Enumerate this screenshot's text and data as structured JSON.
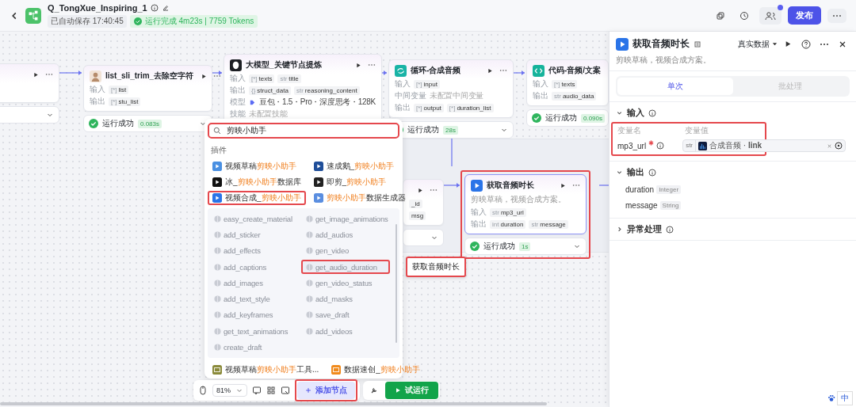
{
  "header": {
    "title": "Q_TongXue_Inspiring_1",
    "autosave": "已自动保存 17:40:45",
    "run_status": "运行完成 4m23s | 7759 Tokens",
    "publish": "发布"
  },
  "nodes": [
    {
      "kind": "full",
      "title": "list_sli_trim_去除空字符",
      "rows": [
        {
          "kind": "params",
          "label": "输入",
          "params": [
            {
              "type": "[*]",
              "name": "list"
            }
          ]
        },
        {
          "kind": "params",
          "label": "输出",
          "params": [
            {
              "type": "[*]",
              "name": "stu_list"
            }
          ]
        }
      ],
      "status": {
        "success": true,
        "text": "运行成功",
        "time": "0.083s"
      }
    },
    {
      "kind": "full",
      "title": "大模型_关键节点提炼",
      "rows": [
        {
          "kind": "params",
          "label": "输入",
          "params": [
            {
              "type": "[*]",
              "name": "texts"
            },
            {
              "type": "str",
              "name": "title"
            }
          ]
        },
        {
          "kind": "params",
          "label": "输出",
          "params": [
            {
              "type": "{}",
              "name": "struct_data"
            },
            {
              "type": "str",
              "name": "reasoning_content"
            }
          ]
        },
        {
          "kind": "text",
          "label": "模型",
          "value": "豆包・1.5・Pro・深度思考・128K",
          "muted": false,
          "logo": true
        },
        {
          "kind": "text",
          "label": "技能",
          "value": "未配置技能",
          "muted": true,
          "logo": false
        }
      ]
    },
    {
      "kind": "full",
      "title": "循环-合成音频",
      "rows": [
        {
          "kind": "params",
          "label": "输入",
          "params": [
            {
              "type": "[*]",
              "name": "input"
            }
          ]
        },
        {
          "kind": "text",
          "label": "中间变量",
          "value": "未配置中间变量",
          "muted": true,
          "logo": false
        },
        {
          "kind": "params",
          "label": "输出",
          "params": [
            {
              "type": "[*]",
              "name": "output"
            },
            {
              "type": "[*]",
              "name": "duration_list"
            }
          ]
        }
      ],
      "status": {
        "success": true,
        "text": "运行成功",
        "time": "28s"
      }
    },
    {
      "kind": "full",
      "title": "代码-音频/文案",
      "rows": [
        {
          "kind": "params",
          "label": "输入",
          "params": [
            {
              "type": "[*]",
              "name": "texts"
            }
          ]
        },
        {
          "kind": "params",
          "label": "输出",
          "params": [
            {
              "type": "str",
              "name": "audio_data"
            }
          ]
        }
      ],
      "status": {
        "success": true,
        "text": "运行成功",
        "time": "0.090s"
      }
    },
    {
      "kind": "stub",
      "tags": [
        "_id",
        "msg"
      ]
    },
    {
      "kind": "full",
      "title": "获取音频时长",
      "description": "剪映草稿，视频合成方案。",
      "rows": [
        {
          "kind": "params",
          "label": "输入",
          "params": [
            {
              "type": "str",
              "name": "mp3_url"
            }
          ]
        },
        {
          "kind": "params",
          "label": "输出",
          "params": [
            {
              "type": "int",
              "name": "duration"
            },
            {
              "type": "str",
              "name": "message"
            }
          ]
        }
      ],
      "status": {
        "success": true,
        "text": "运行成功",
        "time": "1s"
      },
      "annotated": true
    }
  ],
  "add_node_popup": {
    "search": "剪映小助手",
    "search_annotated": true,
    "section": "插件",
    "plugins": [
      {
        "annotated": false,
        "parts": [
          {
            "text": "视频草稿",
            "hit": false
          },
          {
            "text": "剪映小助手",
            "hit": true
          }
        ]
      },
      {
        "annotated": false,
        "parts": [
          {
            "text": "速成鹅_",
            "hit": false
          },
          {
            "text": "剪映小助手",
            "hit": true
          }
        ]
      },
      {
        "annotated": false,
        "parts": [
          {
            "text": "冰_",
            "hit": false
          },
          {
            "text": "剪映小助手",
            "hit": true
          },
          {
            "text": "数据库",
            "hit": false
          }
        ]
      },
      {
        "annotated": false,
        "parts": [
          {
            "text": "即剪_",
            "hit": false
          },
          {
            "text": "剪映小助手",
            "hit": true
          }
        ]
      },
      {
        "annotated": true,
        "parts": [
          {
            "text": "视频合成_",
            "hit": false
          },
          {
            "text": "剪映小助手",
            "hit": true
          }
        ]
      },
      {
        "annotated": false,
        "parts": [
          {
            "text": "剪映小助手",
            "hit": true
          },
          {
            "text": "数据生成器",
            "hit": false
          }
        ]
      }
    ],
    "tools": [
      {
        "name": "easy_create_material",
        "hovered": false
      },
      {
        "name": "get_image_animations",
        "hovered": false
      },
      {
        "name": "add_sticker",
        "hovered": false
      },
      {
        "name": "add_audios",
        "hovered": false
      },
      {
        "name": "add_effects",
        "hovered": false
      },
      {
        "name": "gen_video",
        "hovered": false
      },
      {
        "name": "add_captions",
        "hovered": false
      },
      {
        "name": "get_audio_duration",
        "hovered": true,
        "tooltip": "获取音频时长"
      },
      {
        "name": "add_images",
        "hovered": false
      },
      {
        "name": "gen_video_status",
        "hovered": false
      },
      {
        "name": "add_text_style",
        "hovered": false
      },
      {
        "name": "add_masks",
        "hovered": false
      },
      {
        "name": "add_keyframes",
        "hovered": false
      },
      {
        "name": "save_draft",
        "hovered": false
      },
      {
        "name": "get_text_animations",
        "hovered": false
      },
      {
        "name": "add_videos",
        "hovered": false
      },
      {
        "name": "create_draft",
        "hovered": false
      }
    ],
    "more_plugins": [
      {
        "parts": [
          {
            "text": "视频草稿",
            "hit": false
          },
          {
            "text": "剪映小助手",
            "hit": true
          },
          {
            "text": "工具...",
            "hit": false
          }
        ]
      },
      {
        "parts": [
          {
            "text": "数据速创_",
            "hit": false
          },
          {
            "text": "剪映小助手",
            "hit": true
          }
        ]
      }
    ]
  },
  "toolbar": {
    "zoom": "81%",
    "add_node": "添加节点",
    "add_node_annotated": true,
    "test_run": "试运行"
  },
  "panel": {
    "title": "获取音频时长",
    "data_mode": "真实数据",
    "description": "剪映草稿，视频合成方案。",
    "tabs": [
      {
        "label": "单次",
        "selected": true
      },
      {
        "label": "批处理",
        "selected": false
      }
    ],
    "input": {
      "title": "输入",
      "expanded": true,
      "columns": [
        "变量名",
        "变量值"
      ],
      "annotated": true,
      "params": [
        {
          "name": "mp3_url",
          "required": true,
          "type": "str",
          "value": "合成音频 · **link**"
        }
      ]
    },
    "output": {
      "title": "输出",
      "expanded": true,
      "fields": [
        {
          "name": "duration",
          "type": "Integer"
        },
        {
          "name": "message",
          "type": "String"
        }
      ]
    },
    "error_handling": {
      "title": "异常处理",
      "expanded": false
    }
  },
  "ime": "中"
}
